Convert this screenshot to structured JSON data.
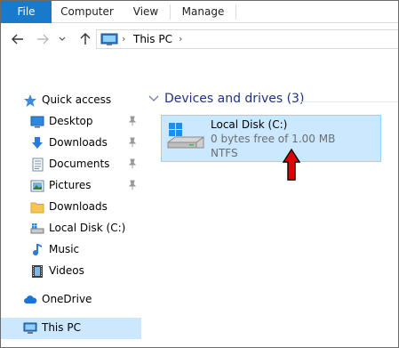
{
  "ribbon": {
    "tabs": [
      "File",
      "Computer",
      "View",
      "Manage"
    ]
  },
  "address": {
    "path": "This PC"
  },
  "nav": {
    "quick_access": "Quick access",
    "items": [
      {
        "label": "Desktop",
        "pinned": true,
        "icon": "desktop-icon"
      },
      {
        "label": "Downloads",
        "pinned": true,
        "icon": "download-icon"
      },
      {
        "label": "Documents",
        "pinned": true,
        "icon": "documents-icon"
      },
      {
        "label": "Pictures",
        "pinned": true,
        "icon": "pictures-icon"
      },
      {
        "label": "Downloads",
        "pinned": false,
        "icon": "folder-icon"
      },
      {
        "label": "Local Disk (C:)",
        "pinned": false,
        "icon": "drive-icon"
      },
      {
        "label": "Music",
        "pinned": false,
        "icon": "music-icon"
      },
      {
        "label": "Videos",
        "pinned": false,
        "icon": "videos-icon"
      }
    ],
    "onedrive": "OneDrive",
    "this_pc": "This PC"
  },
  "content": {
    "group_title": "Devices and drives (3)",
    "drive": {
      "name": "Local Disk (C:)",
      "free": "0 bytes free of 1.00 MB",
      "filesystem": "NTFS",
      "used_fraction": 1.0
    }
  },
  "colors": {
    "file_tab": "#1979ca",
    "selection": "#cce8ff",
    "selection_border": "#99d1ff",
    "group_header": "#1e3287",
    "annotation_arrow": "#e00000"
  }
}
